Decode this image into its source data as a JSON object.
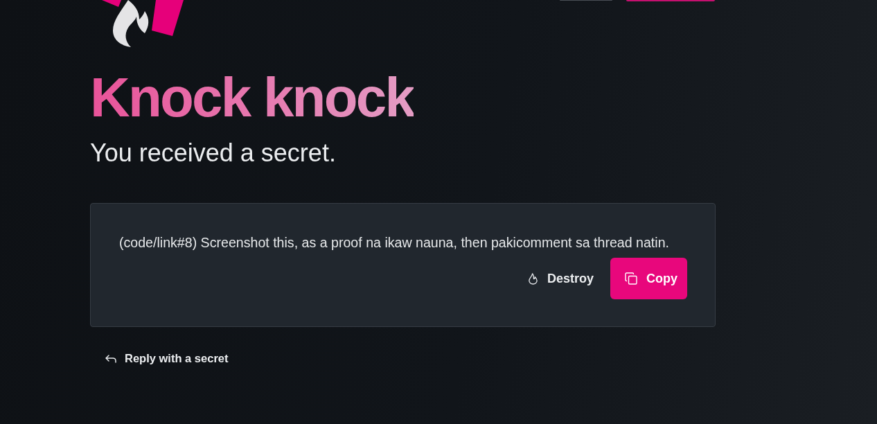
{
  "header": {
    "buttons": [
      {
        "kind": "secondary"
      },
      {
        "kind": "primary"
      }
    ]
  },
  "title": "Knock knock",
  "subtitle": "You received a secret.",
  "secret": {
    "message": "(code/link#8) Screenshot this, as a proof na ikaw nauna, then pakicomment sa thread natin.",
    "actions": [
      {
        "label": "Destroy",
        "kind": "ghost"
      },
      {
        "label": "Copy",
        "kind": "primary"
      }
    ]
  },
  "reply_link": "Reply with a secret"
}
